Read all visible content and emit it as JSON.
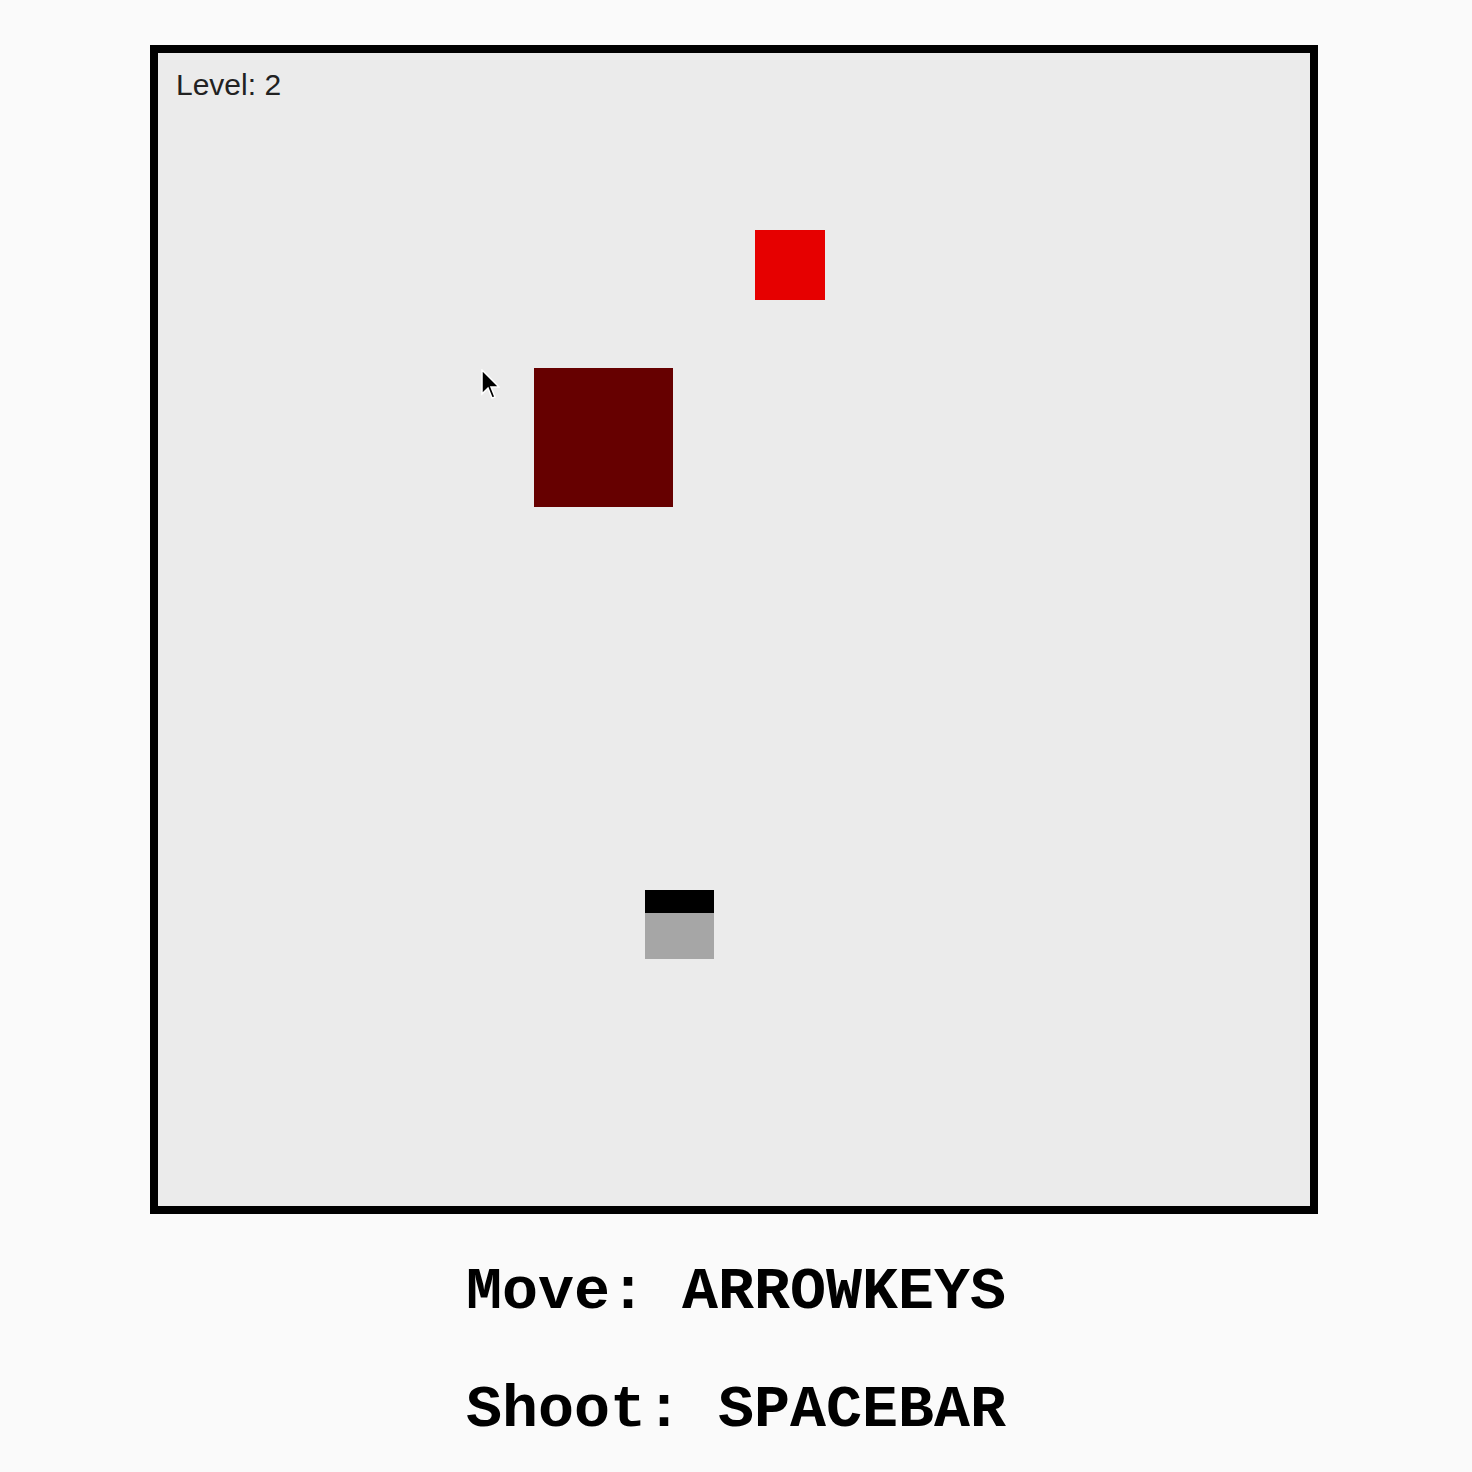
{
  "game": {
    "level_label": "Level: 2",
    "entities": [
      {
        "kind": "enemy",
        "color": "#e60000"
      },
      {
        "kind": "enemy",
        "color": "#660000"
      },
      {
        "kind": "player",
        "color": "#a6a6a6"
      }
    ]
  },
  "controls": [
    {
      "text": "Move: ARROWKEYS"
    },
    {
      "text": "Shoot: SPACEBAR"
    }
  ]
}
